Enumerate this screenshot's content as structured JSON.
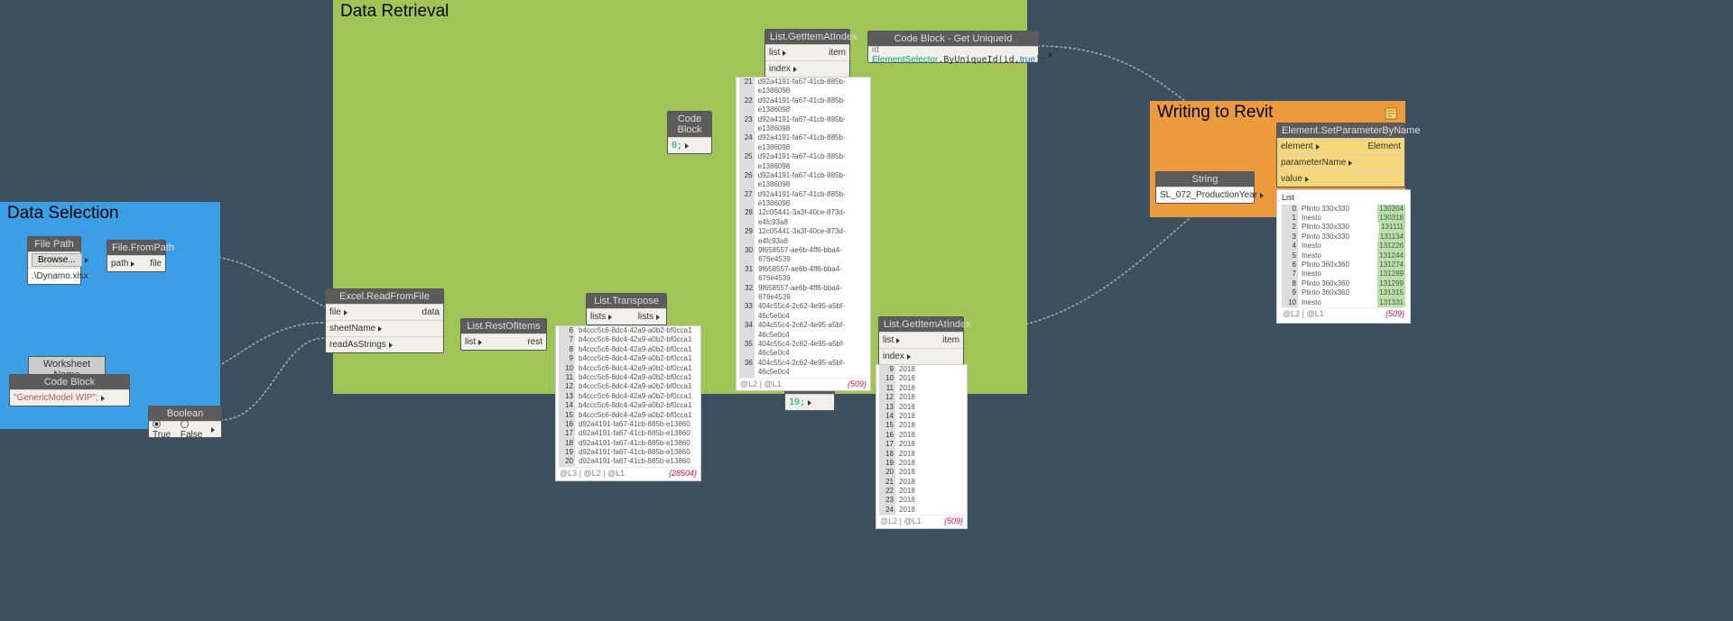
{
  "groups": {
    "ds": {
      "title": "Data Selection"
    },
    "dr": {
      "title": "Data Retrieval"
    },
    "wr": {
      "title": "Writing to Revit"
    }
  },
  "nodes": {
    "filepath": {
      "title": "File Path",
      "btn": "Browse...",
      "value": ".\\Dynamo.xlsx"
    },
    "filefrompath": {
      "title": "File.FromPath",
      "in": "path",
      "out": "file"
    },
    "wsname": {
      "title": "Worksheet Name"
    },
    "cbws": {
      "title": "Code Block",
      "code": "\"GenericModel WIP\";"
    },
    "boolean": {
      "title": "Boolean",
      "t": "True",
      "f": "False"
    },
    "excel": {
      "title": "Excel.ReadFromFile",
      "p1": "file",
      "p2": "sheetName",
      "p3": "readAsStrings",
      "out": "data"
    },
    "restof": {
      "title": "List.RestOfItems",
      "in": "list",
      "out": "rest"
    },
    "transpose": {
      "title": "List.Transpose",
      "in": "lists",
      "out": "lists"
    },
    "cb0": {
      "title": "Code Block",
      "code": "0;"
    },
    "geti1": {
      "title": "List.GetItemAtIndex",
      "p1": "list",
      "p2": "index",
      "out": "item"
    },
    "cbsel": {
      "title": "Code Block - Get UniqueId",
      "code": "id ElementSelector.ByUniqueId(id,true);"
    },
    "cb19": {
      "title": "Code Block",
      "code": "19;"
    },
    "geti2": {
      "title": "List.GetItemAtIndex",
      "p1": "list",
      "p2": "index",
      "out": "item"
    },
    "string": {
      "title": "String",
      "value": "SL_072_ProductionYear"
    },
    "setparam": {
      "title": "Element.SetParameterByName",
      "p1": "element",
      "p2": "parameterName",
      "p3": "value",
      "out": "Element"
    }
  },
  "preview_transpose": {
    "rows": [
      "b4ccc5c6-8dc4-42a9-a0b2-bf0cca1",
      "b4ccc5c6-8dc4-42a9-a0b2-bf0cca1",
      "b4ccc5c6-8dc4-42a9-a0b2-bf0cca1",
      "b4ccc5c6-8dc4-42a9-a0b2-bf0cca1",
      "b4ccc5c6-8dc4-42a9-a0b2-bf0cca1",
      "b4ccc5c6-8dc4-42a9-a0b2-bf0cca1",
      "b4ccc5c6-8dc4-42a9-a0b2-bf0cca1",
      "b4ccc5c6-8dc4-42a9-a0b2-bf0cca1",
      "b4ccc5c6-8dc4-42a9-a0b2-bf0cca1",
      "b4ccc5c6-8dc4-42a9-a0b2-bf0cca1",
      "d92a4191-fa67-41cb-885b-e13860",
      "d92a4191-fa67-41cb-885b-e13860",
      "d92a4191-fa67-41cb-885b-e13860",
      "d92a4191-fa67-41cb-885b-e13860",
      "d92a4191-fa67-41cb-885b-e13860"
    ],
    "start": 6,
    "label": "@L3 | @L2 | @L1",
    "count": "{28504}"
  },
  "preview_geti1": {
    "rows": [
      "d92a4191-fa67-41cb-885b-e1386098",
      "d92a4191-fa67-41cb-885b-e1386098",
      "d92a4191-fa67-41cb-885b-e1386098",
      "d92a4191-fa67-41cb-885b-e1386098",
      "d92a4191-fa67-41cb-885b-e1386098",
      "d92a4191-fa67-41cb-885b-e1386098",
      "d92a4191-fa67-41cb-885b-e1386098",
      "12c05441-3a3f-40ce-873d-e4fc93a8",
      "12c05441-3a3f-40ce-873d-e4fc93a8",
      "9f658557-ae6b-4ff6-bba4-676e4539",
      "9f658557-ae6b-4ff6-bba4-676e4539",
      "9f658557-ae6b-4ff6-bba4-676e4539",
      "404c55c4-2c62-4e95-a5bf-46c5e0c4",
      "404c55c4-2c62-4e95-a5bf-46c5e0c4",
      "404c55c4-2c62-4e95-a5bf-46c5e0c4",
      "404c55c4-2c62-4e95-a5bf-46c5e0c4"
    ],
    "start": 21,
    "label": "@L2 | @L1",
    "count": "{509}"
  },
  "preview_geti2": {
    "rows": [
      "2018",
      "2018",
      "2018",
      "2018",
      "2018",
      "2018",
      "2018",
      "2018",
      "2018",
      "2018",
      "2018",
      "2018",
      "2018",
      "2018",
      "2018",
      "2018"
    ],
    "start": 9,
    "label": "@L2 | @L1",
    "count": "{509}"
  },
  "preview_setparam": {
    "header": "List",
    "items": [
      {
        "i": 0,
        "a": "Plinto 330x330",
        "b": "130204"
      },
      {
        "i": 1,
        "a": "Inesto",
        "b": "130318"
      },
      {
        "i": 2,
        "a": "Plinto 330x330",
        "b": "131111"
      },
      {
        "i": 3,
        "a": "Plinto 330x330",
        "b": "131134"
      },
      {
        "i": 4,
        "a": "Inesto",
        "b": "131226"
      },
      {
        "i": 5,
        "a": "Inesto",
        "b": "131244"
      },
      {
        "i": 6,
        "a": "Plinto 360x360",
        "b": "131274"
      },
      {
        "i": 7,
        "a": "Inesto",
        "b": "131289"
      },
      {
        "i": 8,
        "a": "Plinto 360x360",
        "b": "131299"
      },
      {
        "i": 9,
        "a": "Plinto 360x360",
        "b": "131315"
      },
      {
        "i": 10,
        "a": "Inesto",
        "b": "131331"
      }
    ],
    "label": "@L2 | @L1",
    "count": "{509}"
  }
}
